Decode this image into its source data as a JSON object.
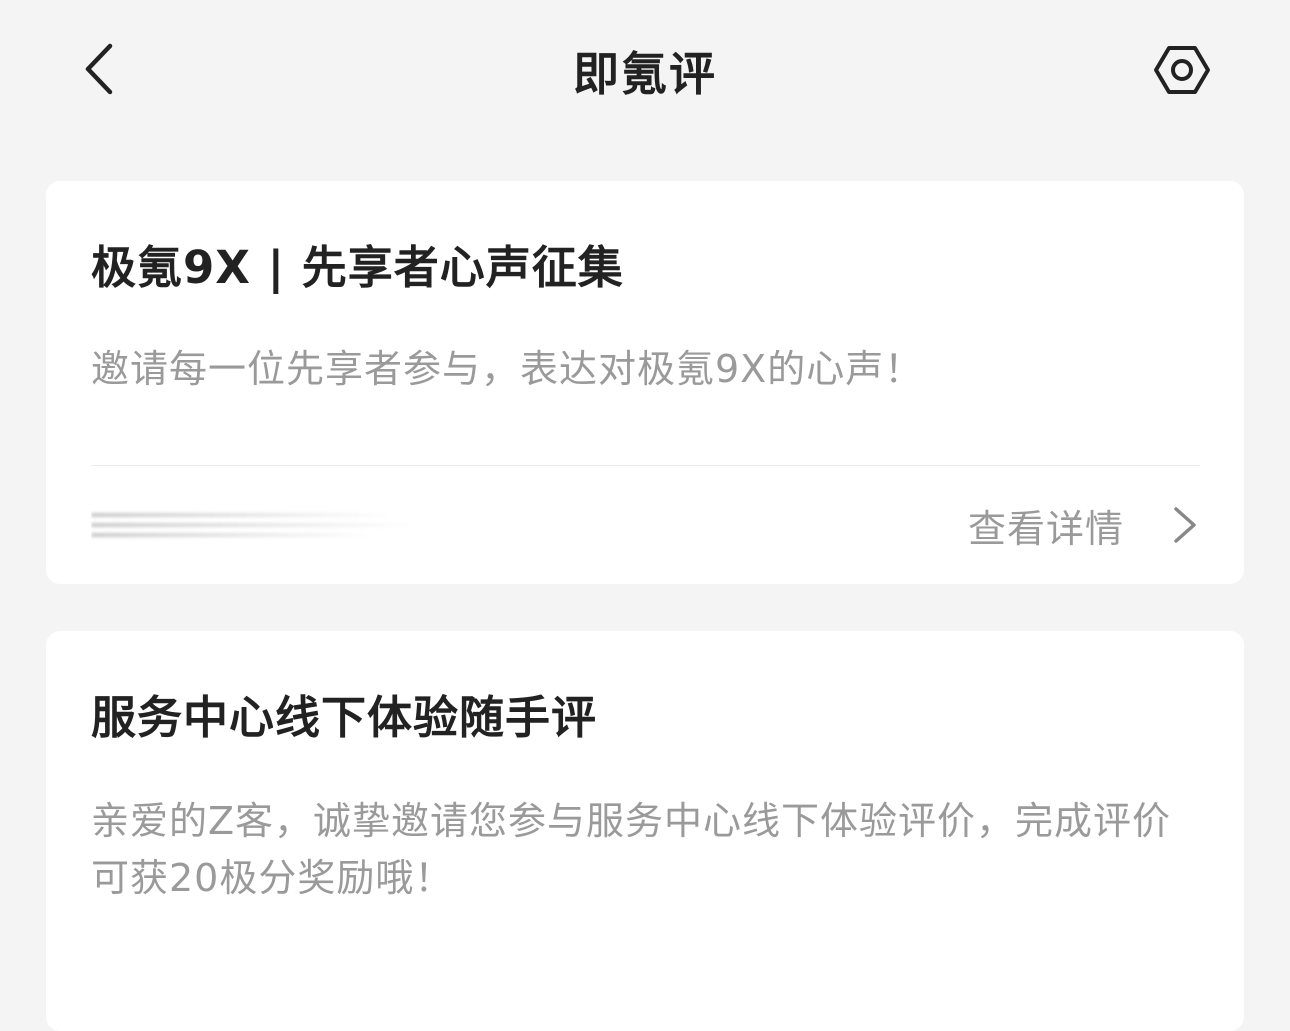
{
  "header": {
    "title": "即氪评"
  },
  "cards": [
    {
      "title": "极氪9X | 先享者心声征集",
      "description": "邀请每一位先享者参与，表达对极氪9X的心声！",
      "action_label": "查看详情"
    },
    {
      "title": "服务中心线下体验随手评",
      "description": "亲爱的Z客，诚挚邀请您参与服务中心线下体验评价，完成评价可获20极分奖励哦！"
    }
  ],
  "icons": {
    "back": "chevron-left-icon",
    "settings": "hexagon-gear-icon",
    "action_chevron": "chevron-right-icon"
  },
  "colors": {
    "page_background": "#f4f4f4",
    "card_background": "#ffffff",
    "title_text": "#222222",
    "secondary_text": "#9a9a9a"
  }
}
